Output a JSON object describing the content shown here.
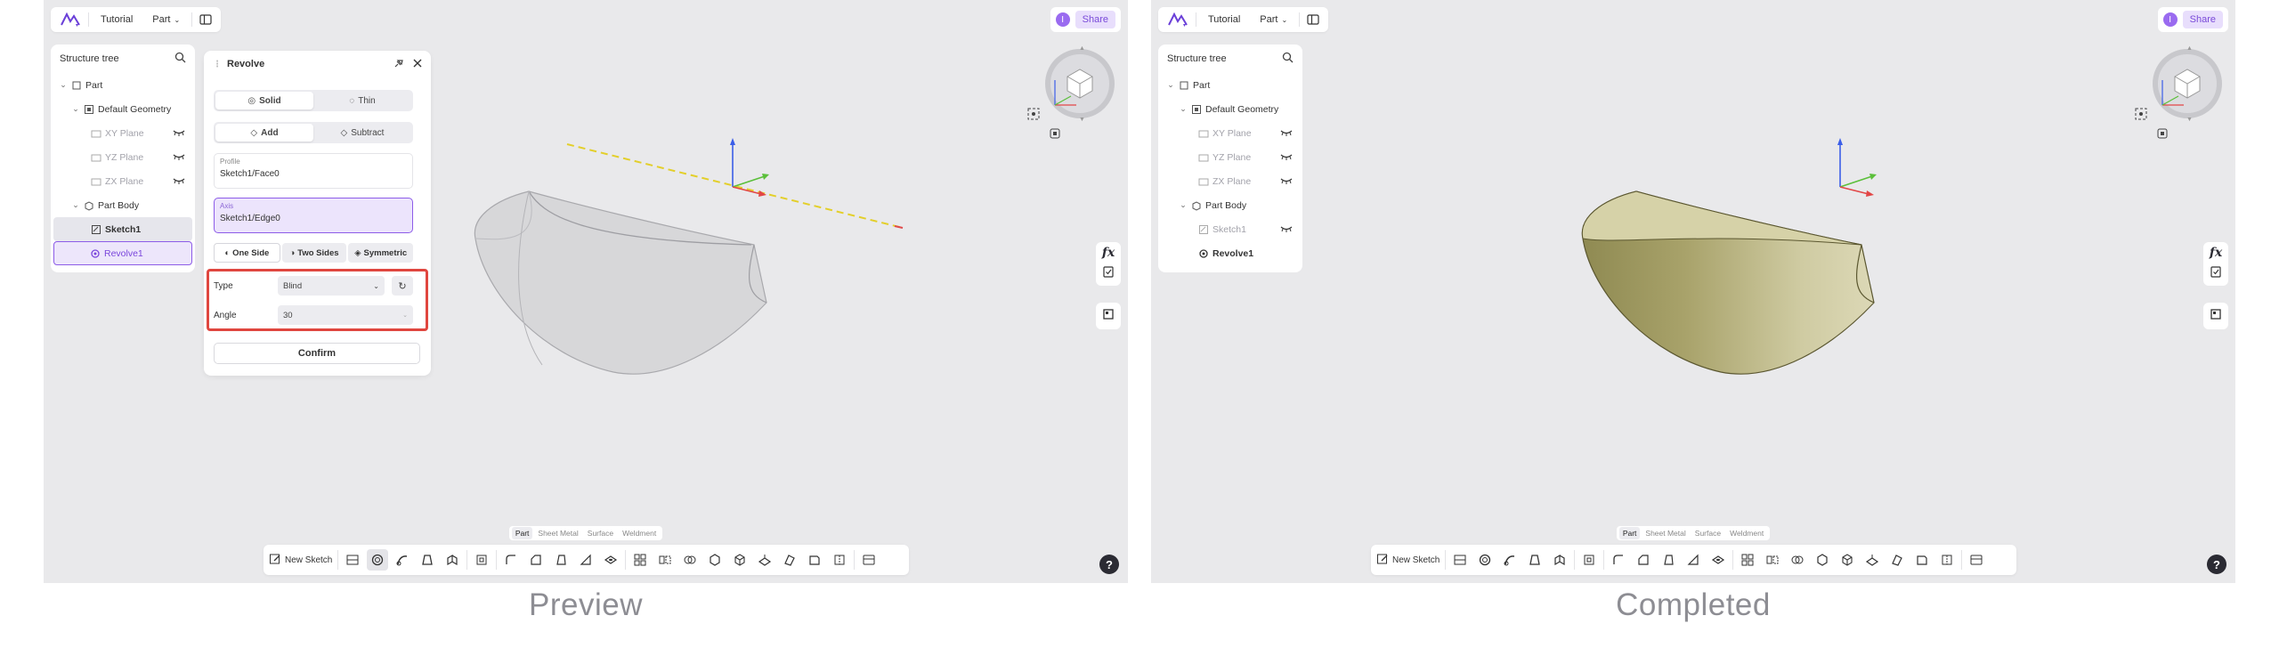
{
  "app": {
    "breadcrumb": [
      "Tutorial",
      "Part"
    ],
    "share_label": "Share",
    "avatar_letter": "I"
  },
  "panels": [
    {
      "caption": "Preview",
      "tree": {
        "title": "Structure tree",
        "items": [
          "Part",
          "Default Geometry",
          "XY Plane",
          "YZ Plane",
          "ZX Plane",
          "Part Body",
          "Sketch1",
          "Revolve1"
        ]
      },
      "revolve": {
        "title": "Revolve",
        "mode_options": [
          "Solid",
          "Thin"
        ],
        "op_options": [
          "Add",
          "Subtract"
        ],
        "profile_label": "Profile",
        "profile_value": "Sketch1/Face0",
        "axis_label": "Axis",
        "axis_value": "Sketch1/Edge0",
        "side_options": [
          "One Side",
          "Two Sides",
          "Symmetric"
        ],
        "type_label": "Type",
        "type_value": "Blind",
        "angle_label": "Angle",
        "angle_value": "30",
        "confirm_label": "Confirm"
      },
      "model_color": "#d2d2d4"
    },
    {
      "caption": "Completed",
      "tree": {
        "title": "Structure tree",
        "items": [
          "Part",
          "Default Geometry",
          "XY Plane",
          "YZ Plane",
          "ZX Plane",
          "Part Body",
          "Sketch1",
          "Revolve1"
        ]
      },
      "model_color": "#c8c49a"
    }
  ],
  "tabs": [
    "Part",
    "Sheet Metal",
    "Surface",
    "Weldment"
  ],
  "toolbar": {
    "new_sketch_label": "New Sketch",
    "tool_icons": [
      "sketch-icon",
      "revolve-icon",
      "sweep-icon",
      "loft-icon",
      "extrude-icon",
      "shell-icon",
      "fillet-icon",
      "chamfer-icon",
      "draft-icon",
      "rib-icon",
      "hole-icon",
      "pattern-icon",
      "mirror-icon",
      "boolean-icon",
      "split-icon",
      "move-body-icon",
      "plane-icon",
      "axis-icon",
      "measure-icon",
      "section-icon"
    ]
  },
  "side": {
    "fx_label": "fx",
    "help_label": "?"
  }
}
